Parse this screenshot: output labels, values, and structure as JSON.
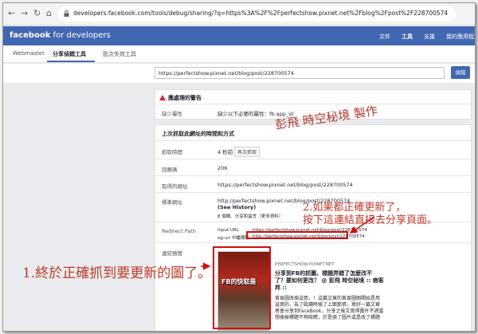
{
  "browser": {
    "url": "developers.facebook.com/tools/debug/sharing/?q=https%3A%2F%2Fperfectshow.pixnet.net%2Fblog%2Fpost%2F228700574"
  },
  "header": {
    "brand_bold": "facebook",
    "brand_rest": " for developers",
    "nav": [
      "文件",
      "工具",
      "支援",
      "我的應用程式"
    ]
  },
  "tabs": [
    "Webmaster",
    "分享偵錯工具",
    "批次失效工具"
  ],
  "input": {
    "value": "https://perfectshow.pixnet.net/blog/post/228700574",
    "button": "偵錯"
  },
  "warnings": {
    "title": "應處理的警告",
    "label": "缺少屬性",
    "value": "缺少以下必要的屬性：fb:app_id"
  },
  "scrape": {
    "title": "上次抓取此網址的時間和方式",
    "rows": [
      {
        "label": "抓取時間",
        "value": "4 秒前"
      },
      {
        "label": "回應碼",
        "value": "206"
      },
      {
        "label": "取得的網址",
        "value": "https://perfectshow.pixnet.net/blog/post/228700574"
      },
      {
        "label": "標準網址",
        "value": "http://perfectshow.pixnet.net/blog/post/228700574"
      }
    ],
    "rescrape_button": "再次抓取",
    "see_history": "(See History)",
    "canonical_note": "8 個讚、分享和留言（更多資料）",
    "redirect_label": "Redirect Path",
    "input_url_label": "Input URL",
    "input_url_value": "https://perfectshow.pixnet.net/blog/post/228700574",
    "ogurl_label": "og:url 中繼標籤",
    "ogurl_value": "http://perfectshow.pixnet.net/blog/post/228700574",
    "preview_label": "連結預覽"
  },
  "preview": {
    "thumb_text": "FB的快取是",
    "domain": "PERFECTSHOW.PIXNET.NET",
    "title_lines": [
      "分享到FB的抓圖，標題弄錯了怎麼改不",
      "了？要如何更改？ @ 彭飛 時空秘境 :: 痞客",
      "邦 ::"
    ],
    "desc_lines": [
      "首頁圖改換這張，！這篇文章的首頁圖剛開始是用",
      "這張的，為了歐讀時換了上面那張，寫好一篇文章",
      "者會分享到FaceBook，分享之後又覺得圖片不適當",
      "想換掉標題不夠吸睛，於是換了圖片或是改了標題"
    ]
  },
  "annotations": {
    "signature": "彭飛 時空秘境 製作",
    "note1": "1.終於正確抓到要更新的圖了。",
    "note2_line1": "2.如果都正確更新了，",
    "note2_line2": "按下這連結直接去分享頁面。"
  },
  "colors": {
    "fb_blue": "#4267b2",
    "annotation_red": "#d01010"
  }
}
